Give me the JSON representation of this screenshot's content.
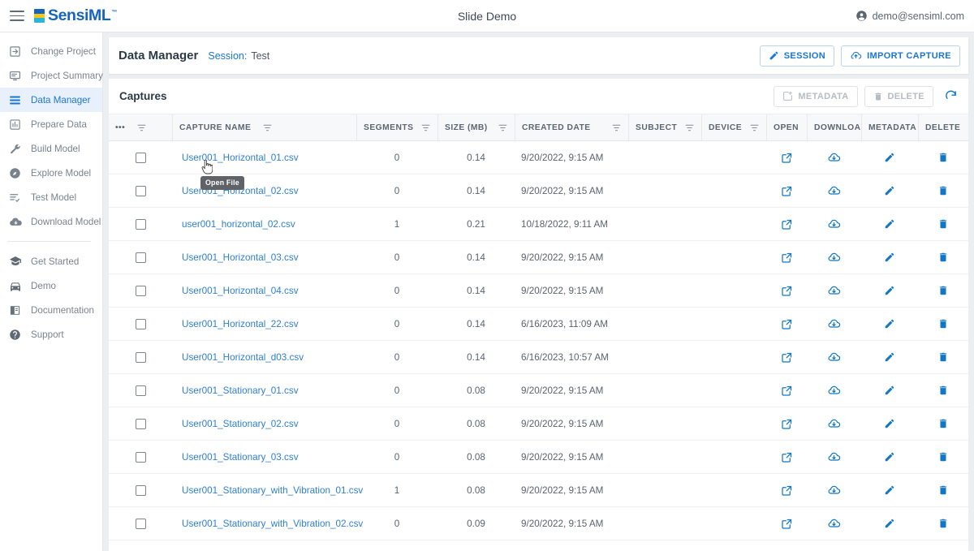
{
  "topbar": {
    "menu_icon": "hamburger-icon",
    "logo_text": "SensiML",
    "logo_tm": "™",
    "window_title": "Slide Demo",
    "account_icon": "account-circle-icon",
    "account_email": "demo@sensiml.com"
  },
  "sidebar": {
    "items": [
      {
        "label": "Change Project",
        "icon": "login-arrow-icon",
        "active": false
      },
      {
        "label": "Project Summary",
        "icon": "monitor-icon",
        "active": false
      },
      {
        "label": "Data Manager",
        "icon": "list-icon",
        "active": true
      },
      {
        "label": "Prepare Data",
        "icon": "bar-chart-icon",
        "active": false
      },
      {
        "label": "Build Model",
        "icon": "wrench-icon",
        "active": false
      },
      {
        "label": "Explore Model",
        "icon": "compass-icon",
        "active": false
      },
      {
        "label": "Test Model",
        "icon": "checklist-icon",
        "active": false
      },
      {
        "label": "Download Model",
        "icon": "cloud-download-icon",
        "active": false
      }
    ],
    "items_secondary": [
      {
        "label": "Get Started",
        "icon": "graduation-cap-icon"
      },
      {
        "label": "Demo",
        "icon": "car-icon"
      },
      {
        "label": "Documentation",
        "icon": "book-icon"
      },
      {
        "label": "Support",
        "icon": "help-circle-icon"
      }
    ]
  },
  "data_manager": {
    "title": "Data Manager",
    "session_label": "Session:",
    "session_value": "Test",
    "session_button": "SESSION",
    "import_button": "IMPORT CAPTURE"
  },
  "captures": {
    "title": "Captures",
    "metadata_button": "METADATA",
    "delete_button": "DELETE",
    "refresh_icon": "refresh-icon",
    "columns": [
      {
        "label": "•••",
        "name": "options",
        "filter": true
      },
      {
        "label": "CAPTURE NAME",
        "name": "capture-name",
        "filter": true
      },
      {
        "label": "SEGMENTS",
        "name": "segments",
        "filter": true
      },
      {
        "label": "SIZE (MB)",
        "name": "size-mb",
        "filter": true
      },
      {
        "label": "CREATED DATE",
        "name": "created-date",
        "filter": true
      },
      {
        "label": "SUBJECT",
        "name": "subject",
        "filter": true
      },
      {
        "label": "DEVICE",
        "name": "device",
        "filter": true
      },
      {
        "label": "OPEN",
        "name": "open",
        "filter": false
      },
      {
        "label": "DOWNLOAD",
        "name": "download",
        "filter": false
      },
      {
        "label": "METADATA",
        "name": "metadata",
        "filter": false
      },
      {
        "label": "DELETE",
        "name": "delete",
        "filter": false
      }
    ],
    "rows": [
      {
        "name": "User001_Horizontal_01.csv",
        "segments": "0",
        "size": "0.14",
        "created": "9/20/2022, 9:15 AM",
        "subject": "",
        "device": ""
      },
      {
        "name": "User001_Horizontal_02.csv",
        "segments": "0",
        "size": "0.14",
        "created": "9/20/2022, 9:15 AM",
        "subject": "",
        "device": ""
      },
      {
        "name": "user001_horizontal_02.csv",
        "segments": "1",
        "size": "0.21",
        "created": "10/18/2022, 9:11 AM",
        "subject": "",
        "device": ""
      },
      {
        "name": "User001_Horizontal_03.csv",
        "segments": "0",
        "size": "0.14",
        "created": "9/20/2022, 9:15 AM",
        "subject": "",
        "device": ""
      },
      {
        "name": "User001_Horizontal_04.csv",
        "segments": "0",
        "size": "0.14",
        "created": "9/20/2022, 9:15 AM",
        "subject": "",
        "device": ""
      },
      {
        "name": "User001_Horizontal_22.csv",
        "segments": "0",
        "size": "0.14",
        "created": "6/16/2023, 11:09 AM",
        "subject": "",
        "device": ""
      },
      {
        "name": "User001_Horizontal_d03.csv",
        "segments": "0",
        "size": "0.14",
        "created": "6/16/2023, 10:57 AM",
        "subject": "",
        "device": ""
      },
      {
        "name": "User001_Stationary_01.csv",
        "segments": "0",
        "size": "0.08",
        "created": "9/20/2022, 9:15 AM",
        "subject": "",
        "device": ""
      },
      {
        "name": "User001_Stationary_02.csv",
        "segments": "0",
        "size": "0.08",
        "created": "9/20/2022, 9:15 AM",
        "subject": "",
        "device": ""
      },
      {
        "name": "User001_Stationary_03.csv",
        "segments": "0",
        "size": "0.08",
        "created": "9/20/2022, 9:15 AM",
        "subject": "",
        "device": ""
      },
      {
        "name": "User001_Stationary_with_Vibration_01.csv",
        "segments": "1",
        "size": "0.08",
        "created": "9/20/2022, 9:15 AM",
        "subject": "",
        "device": ""
      },
      {
        "name": "User001_Stationary_with_Vibration_02.csv",
        "segments": "0",
        "size": "0.09",
        "created": "9/20/2022, 9:15 AM",
        "subject": "",
        "device": ""
      }
    ],
    "row_actions": {
      "open_icon": "open-in-new-icon",
      "download_icon": "cloud-download-icon",
      "metadata_icon": "pencil-icon",
      "delete_icon": "trash-icon"
    }
  },
  "tooltip": {
    "text": "Open File"
  },
  "colors": {
    "accent": "#1976d2",
    "link": "#2f7fd1",
    "icon_blue": "#1177c4",
    "sidebar_active_bg": "#e8f1fb",
    "page_bg": "#eceff1",
    "text_muted": "#79838e"
  }
}
